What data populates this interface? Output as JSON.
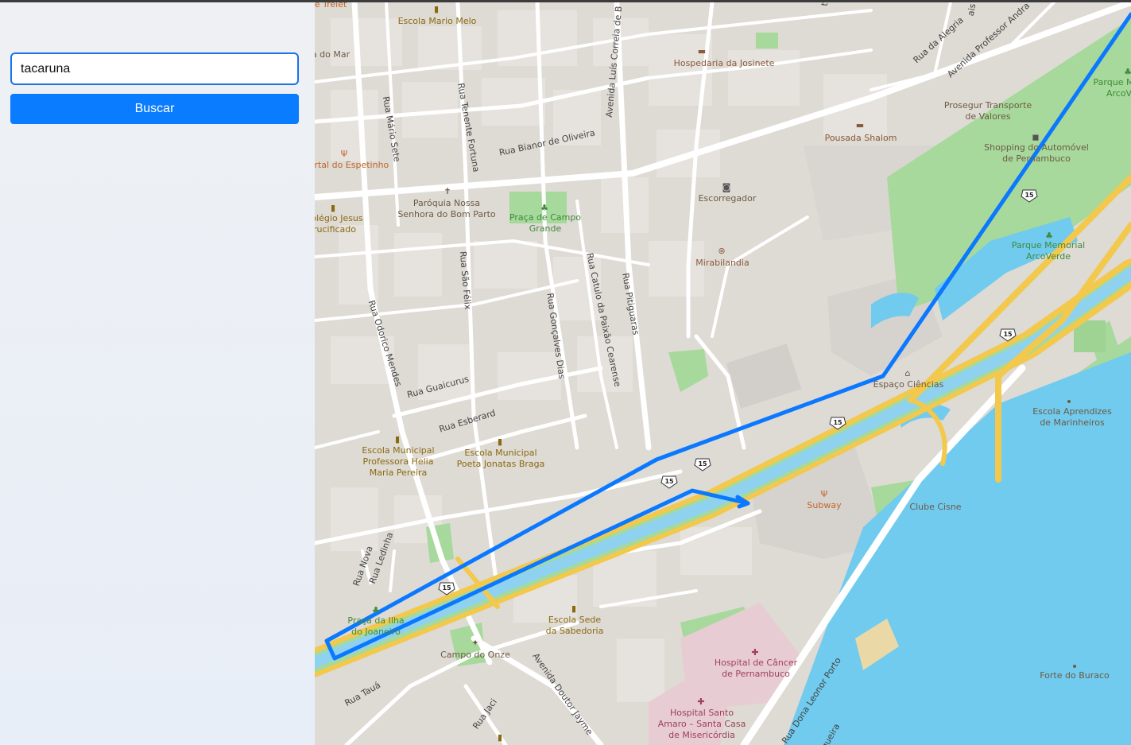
{
  "search": {
    "value": "tacaruna",
    "button_label": "Buscar"
  },
  "map": {
    "route_color": "#0a78ff",
    "water_color": "#70cbee",
    "park_color": "#a6d99b",
    "highway_shield": "15",
    "pois": [
      {
        "name": "Escola Mario Melo",
        "icon": "school-icon",
        "color": "#8a6a10"
      },
      {
        "name": "Hospedaria da Josinete",
        "icon": "bed-icon",
        "color": "#8a5a3a"
      },
      {
        "name": "Prosegur Transporte de Valores",
        "icon": "none",
        "color": "#6e5a45"
      },
      {
        "name": "Pousada Shalom",
        "icon": "bed-icon",
        "color": "#8a5a3a"
      },
      {
        "name": "Shopping do Automóvel de Pernambuco",
        "icon": "car-icon",
        "color": "#6e5a45"
      },
      {
        "name": "Escorregador",
        "icon": "camera-icon",
        "color": "#6e5a45"
      },
      {
        "name": "Mirabilandia",
        "icon": "ferris-wheel-icon",
        "color": "#6e5a45"
      },
      {
        "name": "Parque Memorial ArcoVerde",
        "icon": "tree-icon",
        "color": "#3f8a3a"
      },
      {
        "name": "Parque M ArcoV",
        "icon": "tree-icon",
        "color": "#3f8a3a"
      },
      {
        "name": "Paróquia Nossa Senhora do Bom Parto",
        "icon": "church-icon",
        "color": "#6e5a45"
      },
      {
        "name": "Praça de Campo Grande",
        "icon": "tree-icon",
        "color": "#3f8a3a"
      },
      {
        "name": "ortal do Espetinho",
        "icon": "fork-knife-icon",
        "color": "#c0652a"
      },
      {
        "name": "olégio Jesus rucificado",
        "icon": "school-icon",
        "color": "#8a6a10"
      },
      {
        "name": "a do Mar",
        "icon": "none",
        "color": "#6e5a45"
      },
      {
        "name": "e Trelet",
        "icon": "none",
        "color": "#c0652a"
      },
      {
        "name": "Espaço Ciências",
        "icon": "museum-icon",
        "color": "#6e5a45"
      },
      {
        "name": "Escola Aprendizes de Marinheiros",
        "icon": "none",
        "color": "#6e5a45"
      },
      {
        "name": "Escola Municipal Professora Helia Maria Pereira",
        "icon": "school-icon",
        "color": "#8a6a10"
      },
      {
        "name": "Escola Municipal Poeta Jonatas Braga",
        "icon": "school-icon",
        "color": "#8a6a10"
      },
      {
        "name": "Subway",
        "icon": "fork-knife-icon",
        "color": "#c0652a"
      },
      {
        "name": "Clube Cisne",
        "icon": "none",
        "color": "#6e5a45"
      },
      {
        "name": "Praça da Ilha do Joaneiro",
        "icon": "tree-icon",
        "color": "#3f8a3a"
      },
      {
        "name": "Campo do Onze",
        "icon": "sports-icon",
        "color": "#6e5a45"
      },
      {
        "name": "Escola Sede da Sabedoria",
        "icon": "school-icon",
        "color": "#8a6a10"
      },
      {
        "name": "Hospital de Câncer de Pernambuco",
        "icon": "hospital-icon",
        "color": "#a0405a"
      },
      {
        "name": "Hospital Santo Amaro - Santa Casa de Misericórdia",
        "icon": "hospital-icon",
        "color": "#a0405a"
      },
      {
        "name": "Forte do Buraco",
        "icon": "none",
        "color": "#6e5a45"
      }
    ],
    "streets": [
      "Rua Mário Sete",
      "Rua Tenente Fortuna",
      "Avenida Luís Correia de B",
      "Rua Bianor de Oliveira",
      "Rua da Alegria",
      "Avenida Professor Andra",
      "Rua Odorico Mendes",
      "Rua São Félix",
      "Rua Gonçalves Dias",
      "Rua Catulo da Paixão Cearense",
      "Rua Pitiguaras",
      "Rua Guaicurus",
      "Rua Esberard",
      "Rua Nova",
      "Rua Ledinha",
      "Rua Tauá",
      "Rua Jaci",
      "Avenida Doutor Jayme",
      "Rua Dona Leonor Porto",
      "queira",
      "ais",
      "t"
    ]
  }
}
